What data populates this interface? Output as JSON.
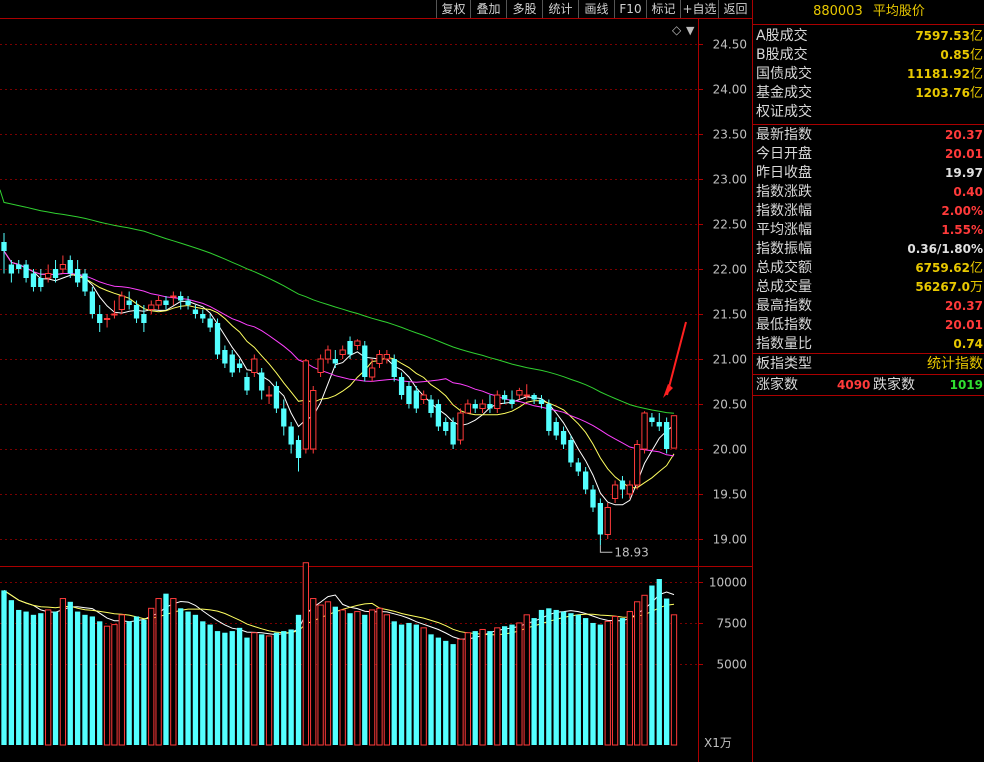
{
  "toolbar": {
    "buttons": [
      "复权",
      "叠加",
      "多股",
      "统计",
      "画线",
      "F10",
      "标记",
      "+自选",
      "返回"
    ]
  },
  "panel": {
    "code": "880003",
    "name": "平均股价",
    "group1": [
      {
        "label": "A股成交",
        "value": "7597.53",
        "unit": "亿",
        "color": "#e8c800"
      },
      {
        "label": "B股成交",
        "value": "0.85",
        "unit": "亿",
        "color": "#e8c800"
      },
      {
        "label": "国债成交",
        "value": "11181.92",
        "unit": "亿",
        "color": "#e8c800"
      },
      {
        "label": "基金成交",
        "value": "1203.76",
        "unit": "亿",
        "color": "#e8c800"
      },
      {
        "label": "权证成交",
        "value": "",
        "unit": "",
        "color": "#e8c800"
      }
    ],
    "group2": [
      {
        "label": "最新指数",
        "value": "20.37",
        "unit": "",
        "color": "#ff3a3a"
      },
      {
        "label": "今日开盘",
        "value": "20.01",
        "unit": "",
        "color": "#ff3a3a"
      },
      {
        "label": "昨日收盘",
        "value": "19.97",
        "unit": "",
        "color": "#e0e0e0"
      },
      {
        "label": "指数涨跌",
        "value": "0.40",
        "unit": "",
        "color": "#ff3a3a"
      },
      {
        "label": "指数涨幅",
        "value": "2.00%",
        "unit": "",
        "color": "#ff3a3a"
      },
      {
        "label": "平均涨幅",
        "value": "1.55%",
        "unit": "",
        "color": "#ff3a3a"
      },
      {
        "label": "指数振幅",
        "value": "0.36/1.80%",
        "unit": "",
        "color": "#e0e0e0"
      },
      {
        "label": "总成交额",
        "value": "6759.62",
        "unit": "亿",
        "color": "#e8c800"
      },
      {
        "label": "总成交量",
        "value": "56267.0",
        "unit": "万",
        "color": "#e8c800"
      },
      {
        "label": "最高指数",
        "value": "20.37",
        "unit": "",
        "color": "#ff3a3a"
      },
      {
        "label": "最低指数",
        "value": "20.01",
        "unit": "",
        "color": "#ff3a3a"
      },
      {
        "label": "指数量比",
        "value": "0.74",
        "unit": "",
        "color": "#e8c800"
      }
    ],
    "type_label": "板指类型",
    "type_value": "统计指数",
    "up_label": "涨家数",
    "up_value": "4090",
    "down_label": "跌家数",
    "down_value": "1019"
  },
  "chart_data": {
    "type": "candlestick",
    "y_ticks": [
      24.5,
      24.0,
      23.5,
      23.0,
      22.5,
      22.0,
      21.5,
      21.0,
      20.5,
      20.0,
      19.5,
      19.0
    ],
    "ylim": [
      18.75,
      24.75
    ],
    "low_label": "18.93",
    "low_value": 18.93,
    "vol_ticks": [
      "10000",
      "7500",
      "5000"
    ],
    "vol_max": 11000,
    "vol_unit": "X1万",
    "colors": {
      "up": "#ff3a3a",
      "down": "#54ffff",
      "ma_white": "#ffffff",
      "ma_yellow": "#ffff60",
      "ma_magenta": "#ff40ff",
      "ma_green": "#30d030",
      "arrow": "#ff2020"
    },
    "ohlc": [
      [
        22.3,
        22.2,
        22.4,
        21.95
      ],
      [
        22.05,
        21.95,
        22.1,
        21.85
      ],
      [
        22.05,
        22.0,
        22.1,
        21.95
      ],
      [
        22.05,
        21.9,
        22.1,
        21.85
      ],
      [
        21.95,
        21.8,
        22.0,
        21.75
      ],
      [
        21.9,
        21.8,
        22.0,
        21.75
      ],
      [
        21.9,
        21.95,
        22.05,
        21.85
      ],
      [
        22.0,
        21.9,
        22.1,
        21.85
      ],
      [
        22.0,
        22.05,
        22.15,
        21.95
      ],
      [
        22.1,
        21.95,
        22.15,
        21.9
      ],
      [
        22.0,
        21.85,
        22.1,
        21.8
      ],
      [
        21.95,
        21.75,
        22.0,
        21.7
      ],
      [
        21.75,
        21.5,
        21.8,
        21.45
      ],
      [
        21.5,
        21.4,
        21.6,
        21.3
      ],
      [
        21.45,
        21.45,
        21.5,
        21.35
      ],
      [
        21.5,
        21.5,
        21.65,
        21.45
      ],
      [
        21.55,
        21.7,
        21.75,
        21.5
      ],
      [
        21.65,
        21.6,
        21.75,
        21.55
      ],
      [
        21.6,
        21.45,
        21.65,
        21.4
      ],
      [
        21.5,
        21.4,
        21.6,
        21.3
      ],
      [
        21.55,
        21.6,
        21.65,
        21.5
      ],
      [
        21.6,
        21.65,
        21.7,
        21.55
      ],
      [
        21.65,
        21.6,
        21.7,
        21.55
      ],
      [
        21.7,
        21.7,
        21.75,
        21.6
      ],
      [
        21.7,
        21.65,
        21.75,
        21.55
      ],
      [
        21.65,
        21.6,
        21.7,
        21.55
      ],
      [
        21.55,
        21.5,
        21.6,
        21.45
      ],
      [
        21.5,
        21.45,
        21.55,
        21.4
      ],
      [
        21.45,
        21.35,
        21.5,
        21.3
      ],
      [
        21.4,
        21.05,
        21.45,
        21.0
      ],
      [
        21.1,
        20.95,
        21.15,
        20.9
      ],
      [
        21.05,
        20.85,
        21.1,
        20.8
      ],
      [
        20.95,
        20.9,
        21.0,
        20.85
      ],
      [
        20.8,
        20.65,
        20.85,
        20.6
      ],
      [
        20.85,
        21.0,
        21.05,
        20.8
      ],
      [
        20.85,
        20.65,
        20.9,
        20.55
      ],
      [
        20.6,
        20.6,
        20.7,
        20.5
      ],
      [
        20.7,
        20.45,
        20.75,
        20.4
      ],
      [
        20.45,
        20.25,
        20.55,
        20.15
      ],
      [
        20.25,
        20.05,
        20.3,
        19.95
      ],
      [
        20.1,
        19.9,
        20.15,
        19.75
      ],
      [
        20.0,
        20.98,
        21.0,
        19.95
      ],
      [
        20.0,
        20.65,
        20.7,
        19.95
      ],
      [
        20.85,
        21.0,
        21.05,
        20.8
      ],
      [
        21.0,
        21.1,
        21.15,
        20.95
      ],
      [
        21.0,
        20.95,
        21.1,
        20.9
      ],
      [
        21.05,
        21.1,
        21.15,
        21.0
      ],
      [
        21.2,
        21.05,
        21.25,
        21.0
      ],
      [
        21.15,
        21.2,
        21.22,
        21.1
      ],
      [
        21.15,
        20.8,
        21.2,
        20.75
      ],
      [
        20.8,
        20.9,
        21.0,
        20.75
      ],
      [
        20.95,
        21.05,
        21.1,
        20.9
      ],
      [
        21.0,
        21.05,
        21.1,
        20.95
      ],
      [
        21.0,
        20.8,
        21.05,
        20.75
      ],
      [
        20.8,
        20.6,
        20.85,
        20.55
      ],
      [
        20.7,
        20.5,
        20.75,
        20.45
      ],
      [
        20.65,
        20.45,
        20.7,
        20.4
      ],
      [
        20.55,
        20.6,
        20.65,
        20.5
      ],
      [
        20.55,
        20.4,
        20.6,
        20.35
      ],
      [
        20.5,
        20.25,
        20.55,
        20.2
      ],
      [
        20.3,
        20.2,
        20.35,
        20.15
      ],
      [
        20.3,
        20.05,
        20.35,
        20.0
      ],
      [
        20.1,
        20.4,
        20.45,
        20.05
      ],
      [
        20.4,
        20.5,
        20.55,
        20.4
      ],
      [
        20.5,
        20.45,
        20.55,
        20.4
      ],
      [
        20.45,
        20.5,
        20.55,
        20.4
      ],
      [
        20.5,
        20.45,
        20.6,
        20.4
      ],
      [
        20.45,
        20.6,
        20.65,
        20.4
      ],
      [
        20.6,
        20.55,
        20.65,
        20.5
      ],
      [
        20.55,
        20.5,
        20.65,
        20.45
      ],
      [
        20.6,
        20.65,
        20.68,
        20.55
      ],
      [
        20.6,
        20.6,
        20.72,
        20.55
      ],
      [
        20.6,
        20.55,
        20.62,
        20.5
      ],
      [
        20.55,
        20.5,
        20.6,
        20.45
      ],
      [
        20.5,
        20.2,
        20.55,
        20.15
      ],
      [
        20.3,
        20.15,
        20.35,
        20.1
      ],
      [
        20.2,
        20.05,
        20.25,
        20.0
      ],
      [
        20.1,
        19.85,
        20.15,
        19.8
      ],
      [
        19.85,
        19.75,
        19.9,
        19.7
      ],
      [
        19.75,
        19.55,
        19.8,
        19.5
      ],
      [
        19.55,
        19.35,
        19.6,
        19.3
      ],
      [
        19.4,
        19.05,
        19.45,
        18.93
      ],
      [
        19.05,
        19.35,
        19.4,
        19.0
      ],
      [
        19.45,
        19.6,
        19.65,
        19.4
      ],
      [
        19.65,
        19.55,
        19.7,
        19.45
      ],
      [
        19.5,
        19.6,
        19.65,
        19.45
      ],
      [
        19.6,
        20.05,
        20.1,
        19.55
      ],
      [
        20.0,
        20.4,
        20.42,
        19.95
      ],
      [
        20.35,
        20.3,
        20.4,
        20.25
      ],
      [
        20.3,
        20.25,
        20.4,
        20.2
      ],
      [
        20.3,
        20.0,
        20.35,
        19.95
      ],
      [
        20.01,
        20.37,
        20.37,
        20.01
      ]
    ],
    "volume": [
      9500,
      8900,
      8300,
      8200,
      8000,
      8100,
      8300,
      8200,
      9000,
      8800,
      8200,
      8000,
      7900,
      7600,
      7300,
      7400,
      8000,
      7600,
      7900,
      7700,
      8400,
      9000,
      9300,
      9000,
      8400,
      8200,
      8000,
      7600,
      7400,
      7000,
      6900,
      7000,
      7200,
      6600,
      6900,
      6800,
      6700,
      6900,
      7000,
      7100,
      8000,
      11200,
      9000,
      8600,
      8800,
      8500,
      8300,
      8100,
      8200,
      8000,
      8300,
      8400,
      8000,
      7600,
      7400,
      7500,
      7400,
      7200,
      6800,
      6600,
      6400,
      6200,
      6500,
      6900,
      7000,
      7100,
      7000,
      7200,
      7300,
      7400,
      7500,
      8000,
      7800,
      8300,
      8400,
      8300,
      8200,
      8100,
      8000,
      7800,
      7500,
      7400,
      7600,
      7900,
      7800,
      8200,
      8800,
      9200,
      9800,
      10200,
      9000,
      8000
    ]
  }
}
